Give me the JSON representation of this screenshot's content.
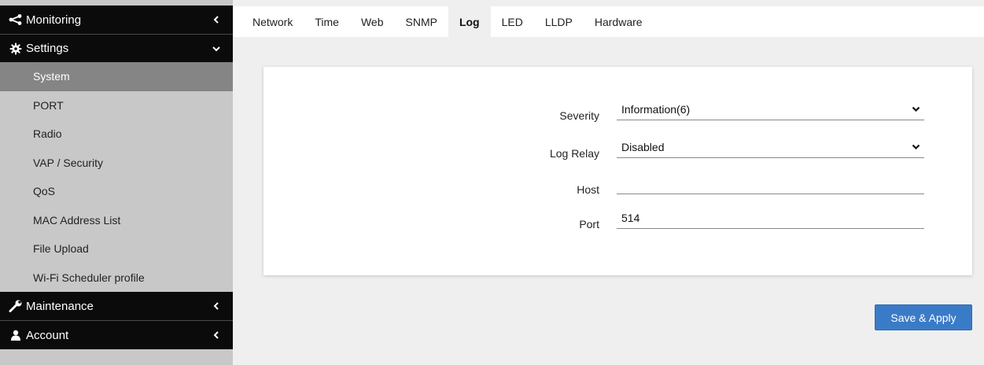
{
  "sidebar": {
    "monitoring": {
      "label": "Monitoring",
      "icon": "share-icon"
    },
    "settings": {
      "label": "Settings",
      "icon": "gear-icon"
    },
    "items": [
      {
        "label": "System",
        "active": true
      },
      {
        "label": "PORT"
      },
      {
        "label": "Radio"
      },
      {
        "label": "VAP / Security"
      },
      {
        "label": "QoS"
      },
      {
        "label": "MAC Address List"
      },
      {
        "label": "File Upload"
      },
      {
        "label": "Wi-Fi Scheduler profile"
      }
    ],
    "maintenance": {
      "label": "Maintenance",
      "icon": "wrench-icon"
    },
    "account": {
      "label": "Account",
      "icon": "user-icon"
    }
  },
  "tabs": [
    {
      "label": "Network"
    },
    {
      "label": "Time"
    },
    {
      "label": "Web"
    },
    {
      "label": "SNMP"
    },
    {
      "label": "Log",
      "active": true
    },
    {
      "label": "LED"
    },
    {
      "label": "LLDP"
    },
    {
      "label": "Hardware"
    }
  ],
  "form": {
    "severity": {
      "label": "Severity",
      "value": "Information(6)"
    },
    "log_relay": {
      "label": "Log Relay",
      "value": "Disabled"
    },
    "host": {
      "label": "Host",
      "value": ""
    },
    "port": {
      "label": "Port",
      "value": "514"
    }
  },
  "actions": {
    "save_label": "Save & Apply"
  },
  "colors": {
    "accent": "#3a7bc8",
    "sidebar_dark": "#0b0b0b",
    "sidebar_bg": "#c8c8c8",
    "sidebar_active": "#858585"
  }
}
